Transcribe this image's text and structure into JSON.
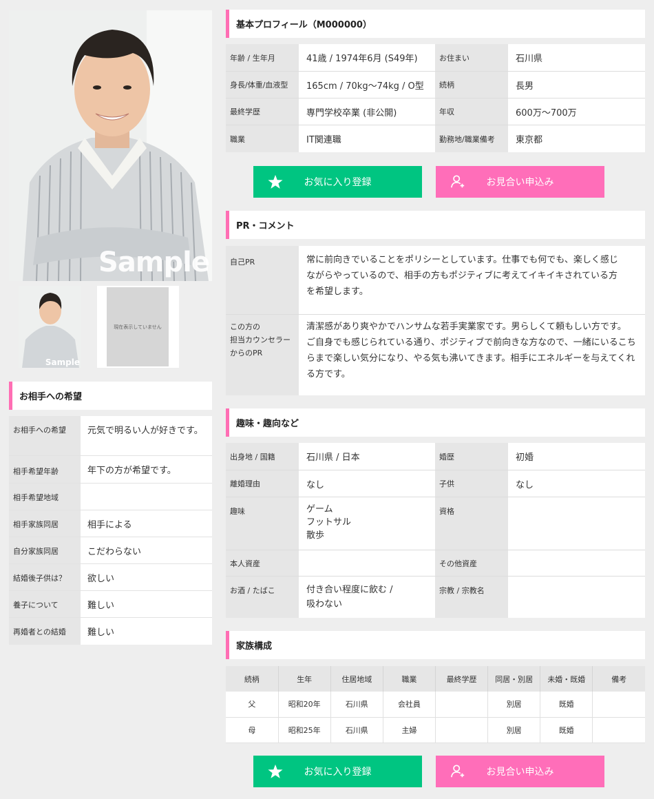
{
  "photo": {
    "watermark": "Sample",
    "thumb_watermark": "Sample",
    "no_image_text": "現在表示していません"
  },
  "preferences": {
    "heading": "お相手への希望",
    "rows": [
      {
        "label": "お相手への希望",
        "value": "元気で明るい人が好きです。"
      },
      {
        "label": "相手希望年齢",
        "value": "年下の方が希望です。"
      },
      {
        "label": "相手希望地域",
        "value": ""
      },
      {
        "label": "相手家族同居",
        "value": "相手による"
      },
      {
        "label": "自分家族同居",
        "value": "こだわらない"
      },
      {
        "label": "結婚後子供は？",
        "value": "欲しい"
      },
      {
        "label": "養子について",
        "value": "難しい"
      },
      {
        "label": "再婚者との結婚",
        "value": "難しい"
      }
    ]
  },
  "basic": {
    "heading": "基本プロフィール（M000000）",
    "rows": [
      {
        "k1": "年齢 / 生年月",
        "v1": "41歳 / 1974年6月 (S49年)",
        "k2": "お住まい",
        "v2": "石川県"
      },
      {
        "k1": "身長/体重/血液型",
        "v1": "165cm / 70kg～74kg / O型",
        "k2": "続柄",
        "v2": "長男"
      },
      {
        "k1": "最終学歴",
        "v1": "専門学校卒業 (非公開)",
        "k2": "年収",
        "v2": "600万～700万"
      },
      {
        "k1": "職業",
        "v1": "IT関連職",
        "k2": "勤務地/職業備考",
        "v2": "東京都"
      }
    ]
  },
  "buttons": {
    "favorite": "お気に入り登録",
    "meeting": "お見合い申込み"
  },
  "pr": {
    "heading": "PR・コメント",
    "self_label": "自己PR",
    "self_lines": [
      "常に前向きでいることをポリシーとしています。仕事でも何でも、楽しく感じ",
      "ながらやっているので、相手の方もポジティブに考えてイキイキされている方",
      "を希望します。"
    ],
    "counselor_label_lines": [
      "この方の",
      "担当カウンセラー",
      "からのPR"
    ],
    "counselor_lines": [
      "清潔感があり爽やかでハンサムな若手実業家です。男らしくて頼もしい方です。",
      "ご自身でも感じられている通り、ポジティブで前向きな方なので、一緒にいるこち",
      "らまで楽しい気分になり、やる気も沸いてきます。相手にエネルギーを与えてくれ",
      "る方です。"
    ]
  },
  "hobby": {
    "heading": "趣味・趣向など",
    "row1": {
      "k1": "出身地 / 国籍",
      "v1": "石川県 / 日本",
      "k2": "婚歴",
      "v2": "初婚"
    },
    "row2": {
      "k1": "離婚理由",
      "v1": "なし",
      "k2": "子供",
      "v2": "なし"
    },
    "row3": {
      "k1": "趣味",
      "v1_lines": [
        "ゲーム",
        "フットサル",
        "散歩"
      ],
      "k2": "資格",
      "v2": ""
    },
    "row4": {
      "k1": "本人資産",
      "v1": "",
      "k2": "その他資産",
      "v2": ""
    },
    "row5": {
      "k1": "お酒 / たばこ",
      "v1_lines": [
        "付き合い程度に飲む /",
        "吸わない"
      ],
      "k2": "宗教 / 宗教名",
      "v2": ""
    }
  },
  "family": {
    "heading": "家族構成",
    "headers": [
      "続柄",
      "生年",
      "住居地域",
      "職業",
      "最終学歴",
      "同居・別居",
      "未婚・既婚",
      "備考"
    ],
    "rows": [
      [
        "父",
        "昭和20年",
        "石川県",
        "会社員",
        "",
        "別居",
        "既婚",
        ""
      ],
      [
        "母",
        "昭和25年",
        "石川県",
        "主婦",
        "",
        "別居",
        "既婚",
        ""
      ]
    ]
  },
  "colors": {
    "accent": "#ff6eb4",
    "favorite": "#00c581",
    "meeting": "#ff6eb9"
  }
}
